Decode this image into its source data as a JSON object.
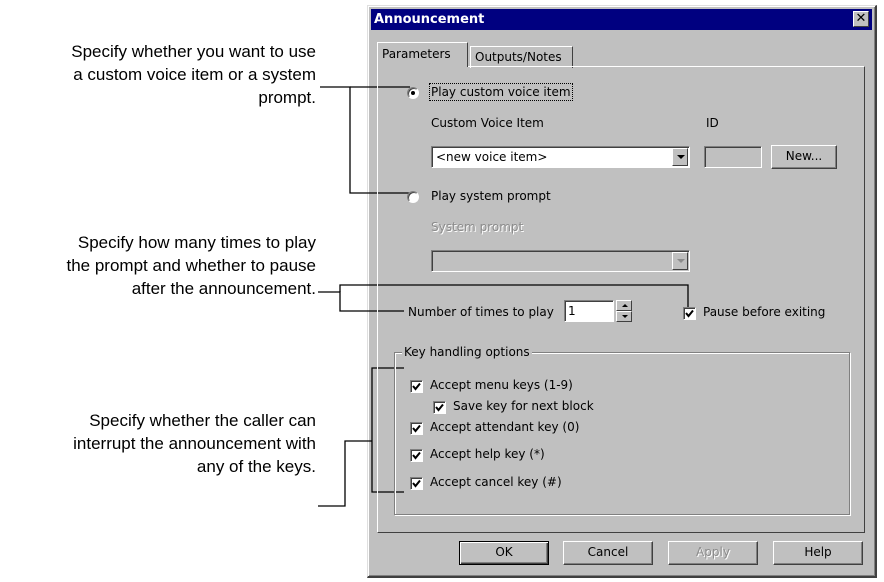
{
  "callouts": {
    "voice": [
      "Specify whether you want to use",
      "a custom voice item or a system",
      "prompt."
    ],
    "play": [
      "Specify how many times to play",
      "the prompt and whether to pause",
      "after the announcement."
    ],
    "keys": [
      "Specify whether the caller can",
      "interrupt the announcement with",
      "any of the keys."
    ]
  },
  "dialog": {
    "title": "Announcement",
    "close_icon": "close-icon",
    "tabs": [
      {
        "label": "Parameters",
        "selected": true
      },
      {
        "label": "Outputs/Notes",
        "selected": false
      }
    ]
  },
  "parameters": {
    "radio_custom": {
      "label": "Play custom voice item",
      "selected": true
    },
    "custom_voice_item_label": "Custom Voice Item",
    "id_label": "ID",
    "custom_voice_select": {
      "value": "<new voice item>"
    },
    "id_value": "",
    "new_button": {
      "label": "New..."
    },
    "radio_system": {
      "label": "Play system prompt",
      "selected": false
    },
    "system_prompt_label": "System prompt",
    "system_prompt_select": {
      "value": ""
    },
    "times_label": "Number of times to play",
    "times_value": "1",
    "pause_checkbox": {
      "label": "Pause before exiting",
      "checked": true
    },
    "key_group": {
      "legend": "Key handling options",
      "items": [
        {
          "label": "Accept menu keys (1-9)",
          "checked": true
        },
        {
          "label": "Save key for next block",
          "checked": true
        },
        {
          "label": "Accept attendant key (0)",
          "checked": true
        },
        {
          "label": "Accept help key (*)",
          "checked": true
        },
        {
          "label": "Accept cancel key (#)",
          "checked": true
        }
      ]
    }
  },
  "buttons": {
    "ok": "OK",
    "cancel": "Cancel",
    "apply": "Apply",
    "help": "Help"
  },
  "colors": {
    "titlebar": "#000080",
    "face": "#c0c0c0",
    "disabled_text": "#8c8c8c"
  }
}
